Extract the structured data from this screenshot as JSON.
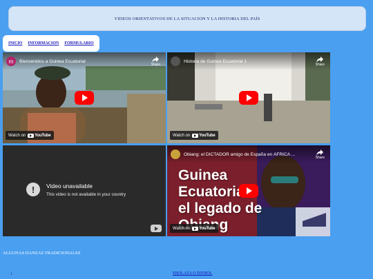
{
  "header": {
    "banner": "VIDEOS ORIENTATIVOS DE LA SITUACION Y LA HISTORIA DEL PAÍS"
  },
  "nav": {
    "items": [
      "INICIO",
      "INFORMACION",
      "FORMULARIO"
    ]
  },
  "videos": [
    {
      "channel_initial": "m",
      "title": "Bienvenidos a Guinea Ecuatorial",
      "share": "Share",
      "watch": "Watch on",
      "yt": "YouTube"
    },
    {
      "channel_initial": "",
      "title": "Historia de Guinea Ecuatorial 1",
      "share": "Share",
      "watch": "Watch on",
      "yt": "YouTube"
    },
    {
      "unavailable_title": "Video unavailable",
      "unavailable_sub": "This video is not available in your country"
    },
    {
      "channel_initial": "",
      "title": "Obiang: el DICTADOR amigo de España en ÁFRICA ...",
      "share": "Share",
      "watch": "Watch on",
      "yt": "YouTube",
      "overlay": [
        "Guinea",
        "Ecuatorial",
        "el legado de",
        "Obiang"
      ]
    }
  ],
  "sections": {
    "danzas": "ALGUNAS DANZAS TRADICIONALES",
    "item_number": "1",
    "item_link": "EBOLAZA O DJEBOL"
  },
  "colors": {
    "page_bg": "#4a9ff0",
    "banner_bg": "#d4e5f7",
    "play_red": "#ff0000",
    "link": "#1313b9"
  }
}
